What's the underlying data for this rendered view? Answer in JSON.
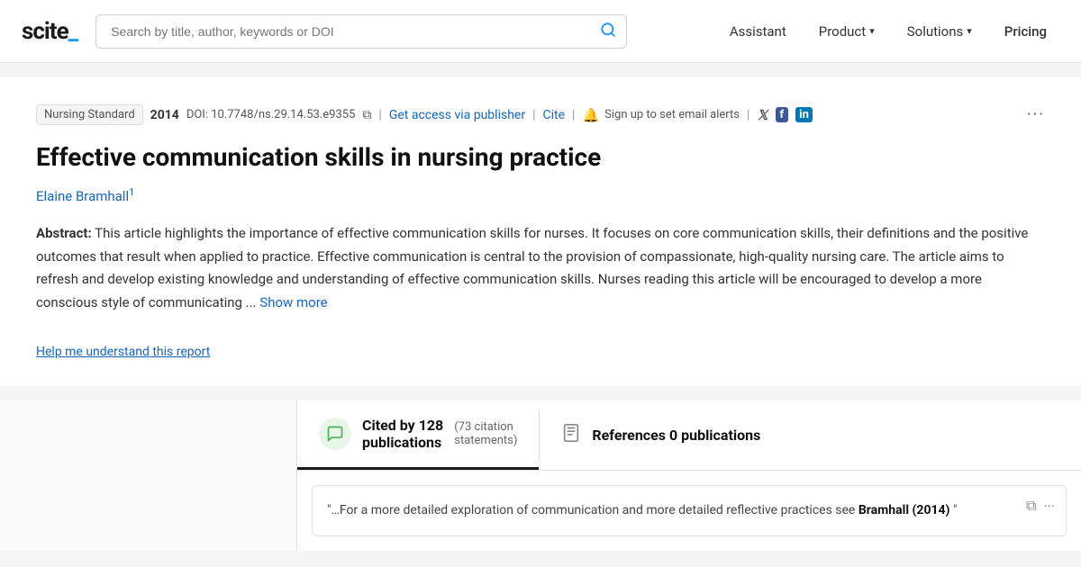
{
  "header": {
    "logo": "scite_",
    "search_placeholder": "Search by title, author, keywords or DOI",
    "nav": {
      "assistant": "Assistant",
      "product": "Product",
      "solutions": "Solutions",
      "pricing": "Pricing"
    }
  },
  "article": {
    "journal": "Nursing Standard",
    "year": "2014",
    "doi": "DOI: 10.7748/ns.29.14.53.e9355",
    "access_link": "Get access via publisher",
    "cite_link": "Cite",
    "alert_text": "Sign up to set email alerts",
    "title": "Effective communication skills in nursing practice",
    "author": "Elaine Bramhall",
    "author_sup": "1",
    "abstract_label": "Abstract:",
    "abstract_text": " This article highlights the importance of effective communication skills for nurses. It focuses on core communication skills, their definitions and the positive outcomes that result when applied to practice. Effective communication is central to the provision of compassionate, high-quality nursing care. The article aims to refresh and develop existing knowledge and understanding of effective communication skills. Nurses reading this article will be encouraged to develop a more conscious style of communicating ...",
    "show_more": "Show more",
    "help_link": "Help me understand this report"
  },
  "citations": {
    "tab_label_line1": "Cited by 128",
    "tab_label_line2": "publications",
    "tab_sub": "(73 citation",
    "tab_sub2": "statements)",
    "references_label": "References 0 publications"
  },
  "citation_card": {
    "quote": "\"…For a more detailed exploration of communication and more detailed reflective practices see",
    "author": "Bramhall (2014)",
    "quote_end": "\""
  },
  "icons": {
    "search": "🔍",
    "bell": "🔔",
    "twitter": "𝕏",
    "facebook": "f",
    "linkedin": "in",
    "copy": "⧉",
    "more": "···",
    "chat": "💬",
    "ref": "📋",
    "copy_card": "⧉",
    "more_card": "···"
  },
  "colors": {
    "blue_link": "#1565c0",
    "accent": "#2196f3",
    "green_bg": "#e8f5e9",
    "green_icon": "#4caf50"
  }
}
